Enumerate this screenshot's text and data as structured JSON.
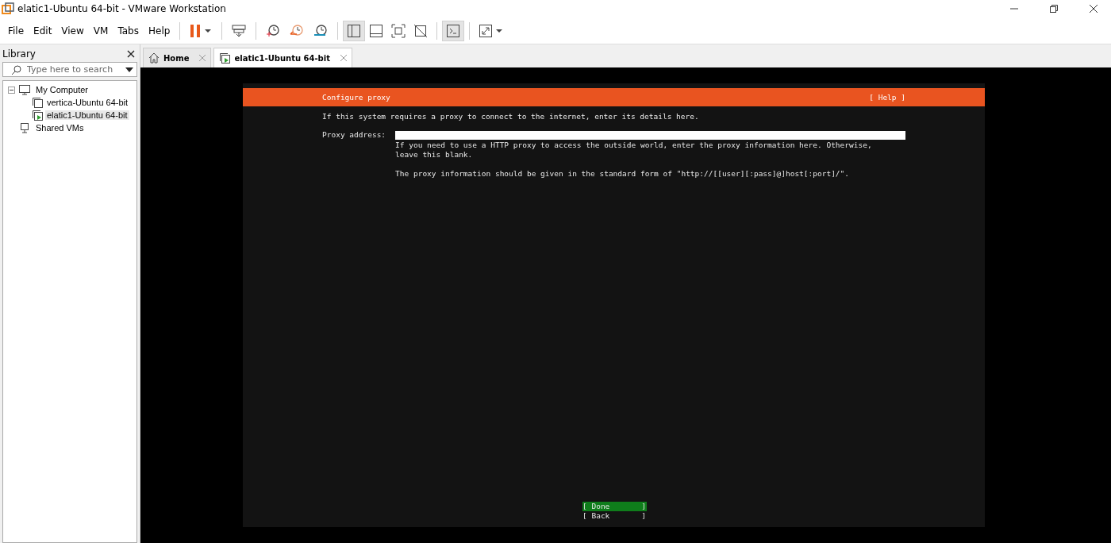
{
  "window": {
    "title": "elatic1-Ubuntu 64-bit - VMware Workstation"
  },
  "menu": [
    "File",
    "Edit",
    "View",
    "VM",
    "Tabs",
    "Help"
  ],
  "toolbar": [
    {
      "kind": "pause",
      "pressed": false
    },
    {
      "kind": "send-keys",
      "pressed": false
    },
    {
      "kind": "snapshot-take",
      "pressed": false
    },
    {
      "kind": "snapshot-revert",
      "pressed": false
    },
    {
      "kind": "snapshot-manager",
      "pressed": false
    },
    {
      "kind": "library-view",
      "pressed": true
    },
    {
      "kind": "thumbnail-view",
      "pressed": false
    },
    {
      "kind": "full-screen",
      "pressed": false
    },
    {
      "kind": "unity",
      "pressed": false
    },
    {
      "kind": "console-view",
      "pressed": true
    },
    {
      "kind": "stretch",
      "pressed": false
    }
  ],
  "library": {
    "title": "Library",
    "search": {
      "placeholder": "Type here to search"
    },
    "tree": [
      {
        "label": "My Computer",
        "kind": "computer",
        "expanded": true,
        "selected": false,
        "children": [
          {
            "label": "vertica-Ubuntu 64-bit",
            "running": false,
            "selected": false
          },
          {
            "label": "elatic1-Ubuntu 64-bit",
            "running": true,
            "selected": true
          }
        ]
      },
      {
        "label": "Shared VMs",
        "kind": "shared",
        "selected": false
      }
    ]
  },
  "tabs": [
    {
      "label": "Home",
      "kind": "home",
      "selected": false
    },
    {
      "label": "elatic1-Ubuntu 64-bit",
      "kind": "vm",
      "selected": true
    }
  ],
  "console": {
    "header": "Configure proxy",
    "help": "[ Help ]",
    "intro": "If this system requires a proxy to connect to the internet, enter its details here.",
    "field_label": "Proxy address:",
    "hint": [
      [
        "If you need to use a HTTP proxy to access the outside world, enter the proxy information here. Otherwise,",
        "leave this blank."
      ],
      [
        "The proxy information should be given in the standard form of \"http://[[user][:pass]@]host[:port]/\"."
      ]
    ],
    "buttons": [
      {
        "label": "[ Done       ]",
        "selected": true
      },
      {
        "label": "[ Back       ]",
        "selected": false
      }
    ]
  }
}
